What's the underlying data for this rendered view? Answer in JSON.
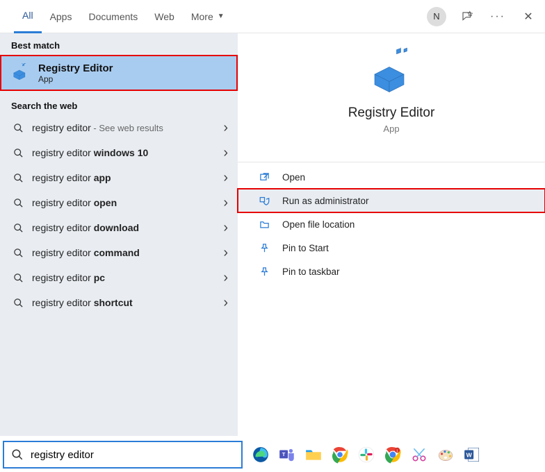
{
  "tabs": {
    "all": "All",
    "apps": "Apps",
    "documents": "Documents",
    "web": "Web",
    "more": "More"
  },
  "user_initial": "N",
  "headers": {
    "best_match": "Best match",
    "search_web": "Search the web"
  },
  "best_match": {
    "title": "Registry Editor",
    "subtitle": "App"
  },
  "web_results": [
    {
      "prefix": "registry editor",
      "bold": "",
      "suffix": " - See web results"
    },
    {
      "prefix": "registry editor ",
      "bold": "windows 10",
      "suffix": ""
    },
    {
      "prefix": "registry editor ",
      "bold": "app",
      "suffix": ""
    },
    {
      "prefix": "registry editor ",
      "bold": "open",
      "suffix": ""
    },
    {
      "prefix": "registry editor ",
      "bold": "download",
      "suffix": ""
    },
    {
      "prefix": "registry editor ",
      "bold": "command",
      "suffix": ""
    },
    {
      "prefix": "registry editor ",
      "bold": "pc",
      "suffix": ""
    },
    {
      "prefix": "registry editor ",
      "bold": "shortcut",
      "suffix": ""
    }
  ],
  "preview": {
    "title": "Registry Editor",
    "subtitle": "App"
  },
  "actions": {
    "open": "Open",
    "run_admin": "Run as administrator",
    "file_loc": "Open file location",
    "pin_start": "Pin to Start",
    "pin_taskbar": "Pin to taskbar"
  },
  "search": {
    "value": "registry editor"
  }
}
